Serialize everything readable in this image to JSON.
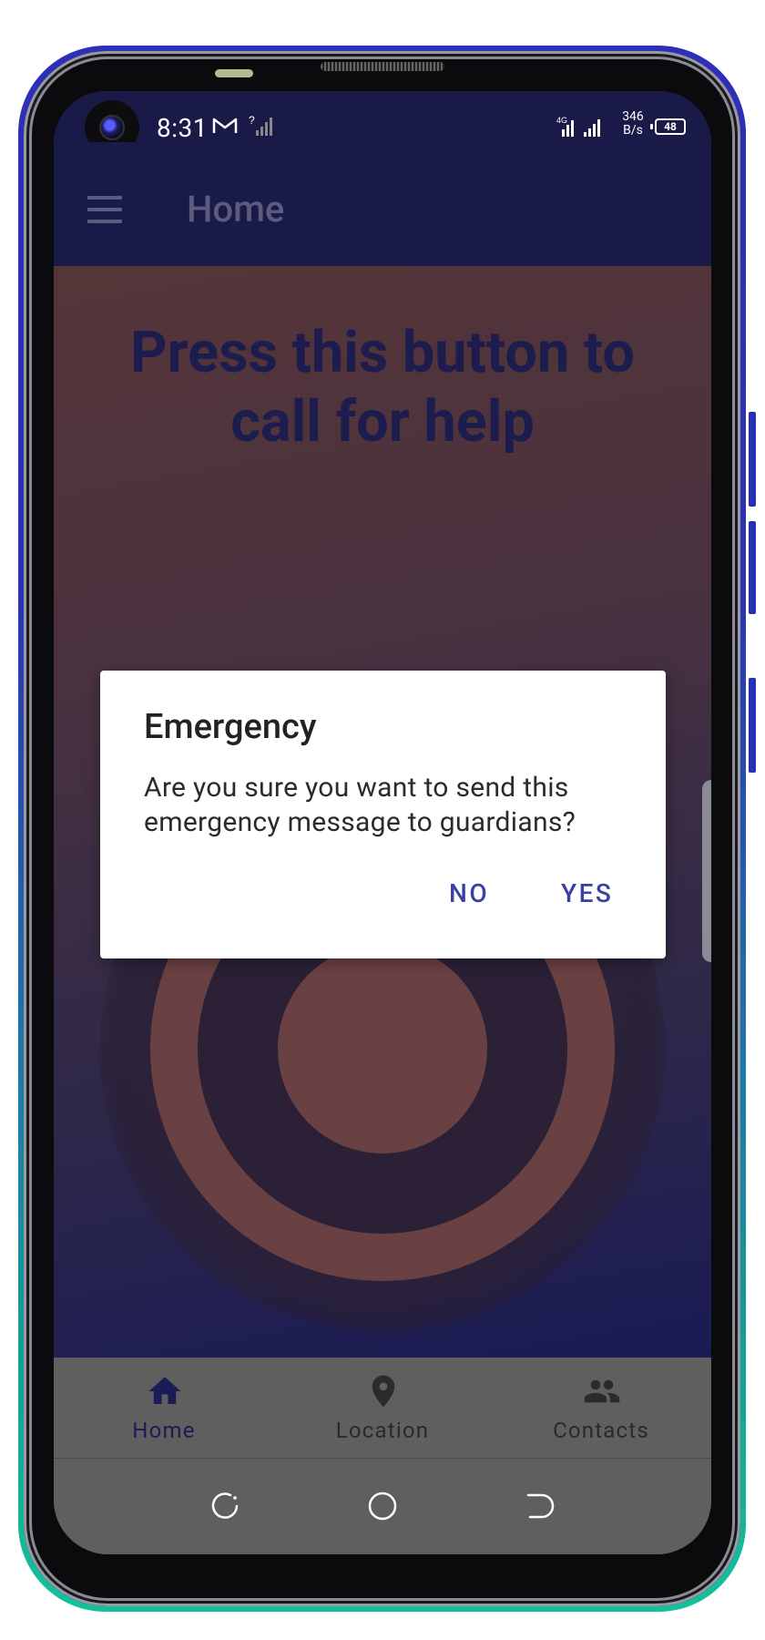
{
  "status_bar": {
    "time": "8:31",
    "net_speed_value": "346",
    "net_speed_unit": "B/s",
    "battery": "48",
    "icons": [
      "gmail-icon",
      "signal-unknown-icon",
      "signal-strength-icon",
      "battery-icon"
    ]
  },
  "app_bar": {
    "title": "Home",
    "menu_icon": "hamburger-menu-icon"
  },
  "main": {
    "headline": "Press this button to call for help",
    "sos_button_icon": "concentric-rings"
  },
  "dialog": {
    "title": "Emergency",
    "message": "Are you sure you want to send this emergency message to guardians?",
    "no_label": "NO",
    "yes_label": "YES"
  },
  "bottom_nav": {
    "items": [
      {
        "label": "Home",
        "icon": "home-icon",
        "active": true
      },
      {
        "label": "Location",
        "icon": "location-pin-icon",
        "active": false
      },
      {
        "label": "Contacts",
        "icon": "contacts-icon",
        "active": false
      }
    ]
  },
  "colors": {
    "app_bar": "#191a48",
    "headline": "#1c1c4f",
    "dialog_button": "#3a40a4",
    "nav_active": "#1b1c55",
    "sos_ring": "#6a4142"
  }
}
